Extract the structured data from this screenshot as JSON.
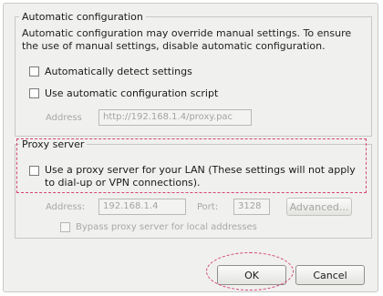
{
  "auto_config": {
    "legend": "Automatic configuration",
    "description": "Automatic configuration may override manual settings.  To ensure the use of manual settings, disable automatic configuration.",
    "detect_label": "Automatically detect settings",
    "script_label": "Use automatic configuration script",
    "address_label": "Address",
    "address_value": "http://192.168.1.4/proxy.pac"
  },
  "proxy": {
    "legend": "Proxy server",
    "use_proxy_label": "Use a proxy server for your LAN (These settings will not apply to dial-up or VPN connections).",
    "address_label": "Address:",
    "address_value": "192.168.1.4",
    "port_label": "Port:",
    "port_value": "3128",
    "advanced_label": "Advanced...",
    "bypass_label": "Bypass proxy server for local addresses"
  },
  "buttons": {
    "ok_label": "OK",
    "cancel_label": "Cancel"
  },
  "highlight_color": "#d2457a"
}
